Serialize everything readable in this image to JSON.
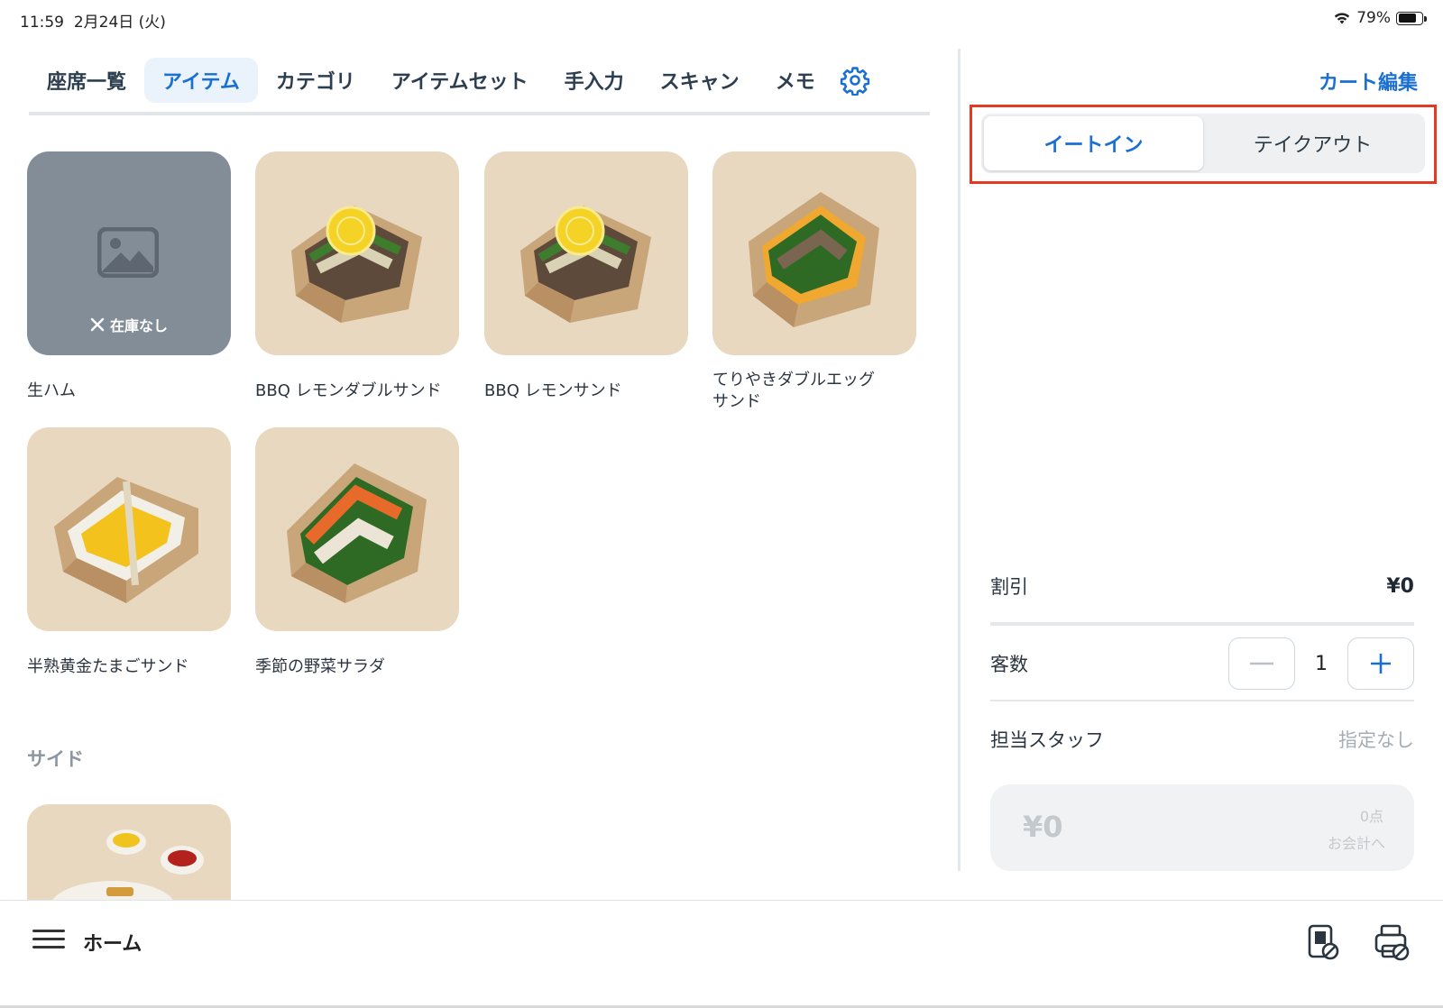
{
  "status_bar": {
    "time": "11:59",
    "date": "2月24日 (火)",
    "battery": "79%",
    "battery_level": 0.79
  },
  "tabs": [
    {
      "label": "座席一覧",
      "active": false
    },
    {
      "label": "アイテム",
      "active": true
    },
    {
      "label": "カテゴリ",
      "active": false
    },
    {
      "label": "アイテムセット",
      "active": false
    },
    {
      "label": "手入力",
      "active": false
    },
    {
      "label": "スキャン",
      "active": false
    },
    {
      "label": "メモ",
      "active": false
    }
  ],
  "settings_icon": "gear-icon",
  "items": [
    {
      "name": "生ハム",
      "out_of_stock": true,
      "stock_label": "在庫なし",
      "image": "placeholder-image-icon"
    },
    {
      "name": "BBQ レモンダブルサンド",
      "out_of_stock": false,
      "image": "bbq-lemon-sandwich"
    },
    {
      "name": "BBQ レモンサンド",
      "out_of_stock": false,
      "image": "bbq-lemon-sandwich"
    },
    {
      "name": "てりやきダブルエッグサンド",
      "name_line1": "てりやきダブルエッグ",
      "name_line2": "サンド",
      "out_of_stock": false,
      "image": "teriyaki-egg-sandwich"
    },
    {
      "name": "半熟黄金たまごサンド",
      "out_of_stock": false,
      "image": "egg-sandwich"
    },
    {
      "name": "季節の野菜サラダ",
      "out_of_stock": false,
      "image": "vegetable-sandwich"
    }
  ],
  "side_section": {
    "title": "サイド",
    "items": [
      {
        "image": "fries-with-sauces"
      }
    ]
  },
  "cart": {
    "edit_label": "カート編集",
    "dining_options": [
      {
        "label": "イートイン",
        "active": true
      },
      {
        "label": "テイクアウト",
        "active": false
      }
    ],
    "discount_label": "割引",
    "discount_value": "¥0",
    "guests_label": "客数",
    "guests_count": "1",
    "staff_label": "担当スタッフ",
    "staff_value": "指定なし",
    "checkout_total": "¥0",
    "checkout_count": "0点",
    "checkout_label": "お会計へ"
  },
  "bottom_bar": {
    "home_label": "ホーム",
    "icons": [
      "receipt-blocked-icon",
      "printer-blocked-icon"
    ]
  },
  "colors": {
    "accent": "#1a6fd1",
    "highlight": "#e53a21",
    "thumb_bg": "#e8d8bf",
    "out_of_stock_bg": "#838d98"
  }
}
